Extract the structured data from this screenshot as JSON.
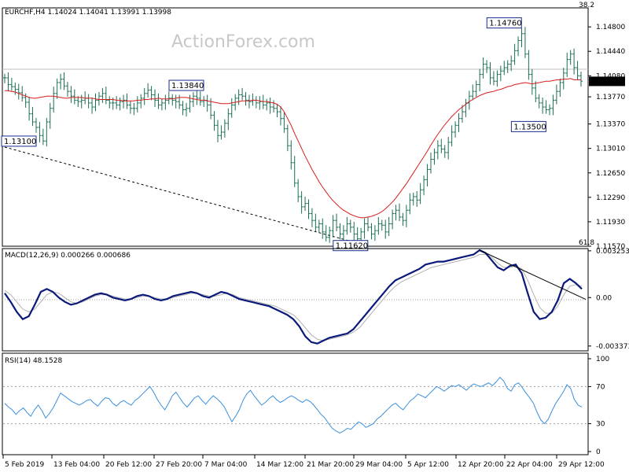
{
  "watermark": "ActionForex.com",
  "price_header": "EURCHF,H4  1.14024 1.14041 1.13991 1.13998",
  "macd_header": "MACD(12,26,9) 0.000266 0.000686",
  "rsi_header": "RSI(14) 48.1528",
  "fib_top": "38.2",
  "fib_bottom": "61.8",
  "current_price_label": "1.13998",
  "colors": {
    "candle": "#1a6e55",
    "ma": "#d81e1e",
    "macd": "#0b1a7a",
    "signal": "#b0b0b0",
    "rsi": "#3a8fdc",
    "current_tag_bg": "#000000",
    "current_tag_text": "#ffffff",
    "box_border": "#1a2d8c"
  },
  "chart_data": [
    {
      "type": "candlestick",
      "name": "EURCHF,H4",
      "ylim": [
        1.1157,
        1.1508
      ],
      "y_ticks": [
        "1.14800",
        "1.14440",
        "1.14080",
        "1.13770",
        "1.13370",
        "1.13010",
        "1.12650",
        "1.12290",
        "1.11930",
        "1.11570"
      ],
      "current_price": 1.13998,
      "close_series": [
        1.1405,
        1.1395,
        1.1392,
        1.1388,
        1.1383,
        1.1376,
        1.1369,
        1.1352,
        1.134,
        1.1332,
        1.132,
        1.1312,
        1.134,
        1.136,
        1.1382,
        1.1398,
        1.1403,
        1.1393,
        1.1385,
        1.1378,
        1.1372,
        1.137,
        1.1372,
        1.1375,
        1.1368,
        1.1362,
        1.1372,
        1.1378,
        1.1382,
        1.1372,
        1.1368,
        1.1368,
        1.1365,
        1.137,
        1.1372,
        1.1365,
        1.136,
        1.136,
        1.1368,
        1.1375,
        1.1382,
        1.1387,
        1.138,
        1.1372,
        1.1365,
        1.1368,
        1.1372,
        1.1375,
        1.1372,
        1.137,
        1.1365,
        1.1358,
        1.136,
        1.137,
        1.1378,
        1.1375,
        1.137,
        1.1372,
        1.1365,
        1.135,
        1.1335,
        1.132,
        1.1325,
        1.1338,
        1.1352,
        1.1365,
        1.1375,
        1.138,
        1.1378,
        1.1372,
        1.137,
        1.1372,
        1.1368,
        1.137,
        1.1365,
        1.1368,
        1.1362,
        1.136,
        1.1355,
        1.1345,
        1.133,
        1.1305,
        1.128,
        1.125,
        1.123,
        1.1215,
        1.122,
        1.1205,
        1.1195,
        1.1185,
        1.119,
        1.1178,
        1.117,
        1.118,
        1.1195,
        1.1185,
        1.1175,
        1.118,
        1.119,
        1.1185,
        1.1175,
        1.1168,
        1.1178,
        1.119,
        1.1185,
        1.1175,
        1.118,
        1.119,
        1.1188,
        1.1178,
        1.119,
        1.1205,
        1.121,
        1.12,
        1.1195,
        1.121,
        1.1225,
        1.123,
        1.1225,
        1.124,
        1.1255,
        1.127,
        1.1285,
        1.1295,
        1.1305,
        1.13,
        1.1295,
        1.131,
        1.1325,
        1.1335,
        1.1345,
        1.1355,
        1.1368,
        1.1378,
        1.1385,
        1.1395,
        1.141,
        1.1425,
        1.142,
        1.1405,
        1.14,
        1.141,
        1.1415,
        1.142,
        1.1425,
        1.143,
        1.1445,
        1.146,
        1.147,
        1.144,
        1.141,
        1.139,
        1.1375,
        1.1368,
        1.1362,
        1.1358,
        1.136,
        1.1372,
        1.1385,
        1.1398,
        1.1412,
        1.1432,
        1.144,
        1.142,
        1.1408,
        1.14
      ],
      "ma_series": [
        1.1386,
        1.1386,
        1.1385,
        1.1384,
        1.1382,
        1.138,
        1.1378,
        1.1376,
        1.1375,
        1.1375,
        1.1376,
        1.1377,
        1.1378,
        1.1378,
        1.1378,
        1.1377,
        1.1376,
        1.1375,
        1.1375,
        1.1376,
        1.1376,
        1.1376,
        1.1376,
        1.1375,
        1.1375,
        1.1375,
        1.1374,
        1.1373,
        1.1373,
        1.1373,
        1.1373,
        1.1373,
        1.1372,
        1.1372,
        1.1371,
        1.1371,
        1.1371,
        1.1371,
        1.1372,
        1.1372,
        1.1373,
        1.1373,
        1.1374,
        1.1374,
        1.1375,
        1.1374,
        1.1374,
        1.1374,
        1.1374,
        1.1375,
        1.1376,
        1.1376,
        1.1376,
        1.1375,
        1.1374,
        1.1373,
        1.1372,
        1.1372,
        1.1371,
        1.137,
        1.1369,
        1.1368,
        1.1367,
        1.1367,
        1.1367,
        1.1368,
        1.1369,
        1.137,
        1.1371,
        1.1371,
        1.1371,
        1.1372,
        1.1372,
        1.1371,
        1.137,
        1.137,
        1.1369,
        1.1368,
        1.1366,
        1.1362,
        1.1355,
        1.1345,
        1.1335,
        1.1323,
        1.1312,
        1.1301,
        1.129,
        1.128,
        1.127,
        1.1261,
        1.1252,
        1.1244,
        1.1237,
        1.123,
        1.1224,
        1.1219,
        1.1214,
        1.121,
        1.1207,
        1.1204,
        1.1202,
        1.12,
        1.1199,
        1.1199,
        1.12,
        1.1201,
        1.1203,
        1.1205,
        1.1208,
        1.1212,
        1.1217,
        1.1222,
        1.1228,
        1.1235,
        1.1242,
        1.1249,
        1.1257,
        1.1265,
        1.1273,
        1.1281,
        1.1289,
        1.1297,
        1.1306,
        1.1314,
        1.1322,
        1.1329,
        1.1336,
        1.1342,
        1.1348,
        1.1353,
        1.1358,
        1.1362,
        1.1366,
        1.137,
        1.1373,
        1.1376,
        1.1379,
        1.1381,
        1.1383,
        1.1384,
        1.1385,
        1.1387,
        1.1388,
        1.139,
        1.1392,
        1.1393,
        1.1395,
        1.1396,
        1.1397,
        1.1398,
        1.1397,
        1.1396,
        1.1397,
        1.1398,
        1.1399,
        1.14,
        1.14,
        1.1401,
        1.1402,
        1.1402,
        1.1403,
        1.1403,
        1.1404,
        1.1402,
        1.1402,
        1.1402
      ],
      "annotations": [
        {
          "text": "1.14760",
          "x_index": 143,
          "price": 1.1476
        },
        {
          "text": "1.13840",
          "x_index": 52,
          "price": 1.1384
        },
        {
          "text": "1.13500",
          "x_index": 150,
          "price": 1.135
        },
        {
          "text": "1.13100",
          "x_index": 0,
          "price": 1.131
        },
        {
          "text": "1.11620",
          "x_index": 99,
          "price": 1.1162
        }
      ],
      "trendline": [
        {
          "x_index": 0,
          "price": 1.1303
        },
        {
          "x_index": 100,
          "price": 1.1163
        }
      ],
      "grid": false
    },
    {
      "type": "line",
      "name": "MACD(12,26,9)",
      "ylim": [
        -0.0036,
        0.0033
      ],
      "y_ticks": [
        "0.003253",
        "0.00",
        "-0.003373"
      ],
      "macd_series": [
        0.0003,
        -0.0003,
        -0.001,
        -0.0015,
        -0.0013,
        -0.0005,
        0.0004,
        0.0006,
        0.0004,
        0.0,
        -0.0003,
        -0.0005,
        -0.0004,
        -0.0002,
        0.0,
        0.0002,
        0.0003,
        0.0002,
        0.0,
        -0.0001,
        -0.0002,
        -0.0001,
        0.0001,
        0.0002,
        0.0001,
        -0.0001,
        -0.0002,
        -0.0001,
        0.0001,
        0.0002,
        0.0003,
        0.0004,
        0.0003,
        0.0001,
        0.0,
        0.0002,
        0.0004,
        0.0003,
        0.0001,
        -0.0001,
        -0.0002,
        -0.0003,
        -0.0004,
        -0.0005,
        -0.0006,
        -0.0008,
        -0.001,
        -0.0012,
        -0.0015,
        -0.002,
        -0.0027,
        -0.0031,
        -0.0032,
        -0.003,
        -0.0028,
        -0.0027,
        -0.0026,
        -0.0025,
        -0.0022,
        -0.0017,
        -0.0012,
        -0.0007,
        -0.0002,
        0.0003,
        0.0008,
        0.0012,
        0.0014,
        0.0016,
        0.0018,
        0.002,
        0.0023,
        0.0024,
        0.0025,
        0.0025,
        0.0026,
        0.0027,
        0.0028,
        0.0029,
        0.003,
        0.0033,
        0.0031,
        0.0026,
        0.0021,
        0.0019,
        0.0022,
        0.0023,
        0.0017,
        0.0003,
        -0.001,
        -0.0015,
        -0.0014,
        -0.001,
        -0.0002,
        0.001,
        0.0013,
        0.001,
        0.0006
      ],
      "signal_series": [
        0.0005,
        0.0002,
        -0.0003,
        -0.0008,
        -0.001,
        -0.0008,
        -0.0003,
        0.0002,
        0.0004,
        0.0003,
        0.0,
        -0.0003,
        -0.0004,
        -0.0003,
        -0.0001,
        0.0001,
        0.0002,
        0.0002,
        0.0001,
        0.0,
        -0.0001,
        -0.0001,
        0.0,
        0.0001,
        0.0001,
        0.0,
        -0.0001,
        -0.0001,
        0.0,
        0.0001,
        0.0002,
        0.0003,
        0.0003,
        0.0002,
        0.0001,
        0.0001,
        0.0002,
        0.0003,
        0.0002,
        0.0,
        -0.0001,
        -0.0002,
        -0.0003,
        -0.0004,
        -0.0005,
        -0.0006,
        -0.0008,
        -0.001,
        -0.0012,
        -0.0016,
        -0.0021,
        -0.0026,
        -0.0029,
        -0.003,
        -0.0029,
        -0.0028,
        -0.0027,
        -0.0026,
        -0.0024,
        -0.0021,
        -0.0016,
        -0.0011,
        -0.0006,
        -0.0001,
        0.0004,
        0.0008,
        0.0011,
        0.0013,
        0.0015,
        0.0017,
        0.0019,
        0.0021,
        0.0022,
        0.0023,
        0.0024,
        0.0025,
        0.0026,
        0.0027,
        0.0028,
        0.003,
        0.003,
        0.0028,
        0.0024,
        0.0021,
        0.0021,
        0.0022,
        0.002,
        0.0012,
        0.0002,
        -0.0007,
        -0.0011,
        -0.0011,
        -0.0006,
        0.0002,
        0.0008,
        0.0009,
        0.0008
      ],
      "trendline": [
        {
          "index": 79,
          "value": 0.0033
        },
        {
          "index": 96,
          "value": 0.0002
        }
      ],
      "grid": false
    },
    {
      "type": "line",
      "name": "RSI(14)",
      "ylim": [
        0,
        100
      ],
      "y_ticks": [
        "100",
        "70",
        "30",
        "0"
      ],
      "levels": [
        70,
        30
      ],
      "rsi_series": [
        52,
        48,
        45,
        40,
        44,
        47,
        42,
        38,
        45,
        50,
        44,
        36,
        41,
        47,
        55,
        63,
        60,
        57,
        54,
        52,
        50,
        52,
        55,
        56,
        52,
        49,
        54,
        58,
        57,
        52,
        49,
        53,
        55,
        52,
        50,
        55,
        58,
        62,
        66,
        70,
        64,
        56,
        50,
        45,
        52,
        60,
        64,
        58,
        52,
        48,
        53,
        58,
        60,
        55,
        51,
        56,
        60,
        57,
        53,
        48,
        40,
        32,
        38,
        45,
        55,
        62,
        66,
        60,
        55,
        50,
        53,
        57,
        60,
        56,
        53,
        55,
        58,
        60,
        58,
        55,
        53,
        56,
        54,
        50,
        45,
        40,
        36,
        30,
        25,
        22,
        20,
        22,
        25,
        24,
        28,
        32,
        30,
        26,
        28,
        30,
        35,
        38,
        42,
        46,
        50,
        52,
        48,
        45,
        50,
        55,
        58,
        62,
        60,
        58,
        62,
        66,
        70,
        68,
        65,
        68,
        71,
        70,
        72,
        69,
        66,
        70,
        73,
        71,
        70,
        72,
        74,
        71,
        75,
        80,
        76,
        68,
        65,
        72,
        74,
        69,
        63,
        58,
        52,
        42,
        34,
        30,
        35,
        44,
        52,
        58,
        64,
        72,
        68,
        56,
        50,
        48
      ],
      "grid": false
    }
  ],
  "x_labels": [
    "5 Feb 2019",
    "13 Feb 04:00",
    "20 Feb 12:00",
    "27 Feb 20:00",
    "7 Mar 04:00",
    "14 Mar 12:00",
    "21 Mar 20:00",
    "29 Mar 04:00",
    "5 Apr 12:00",
    "12 Apr 20:00",
    "22 Apr 04:00",
    "29 Apr 12:00"
  ]
}
